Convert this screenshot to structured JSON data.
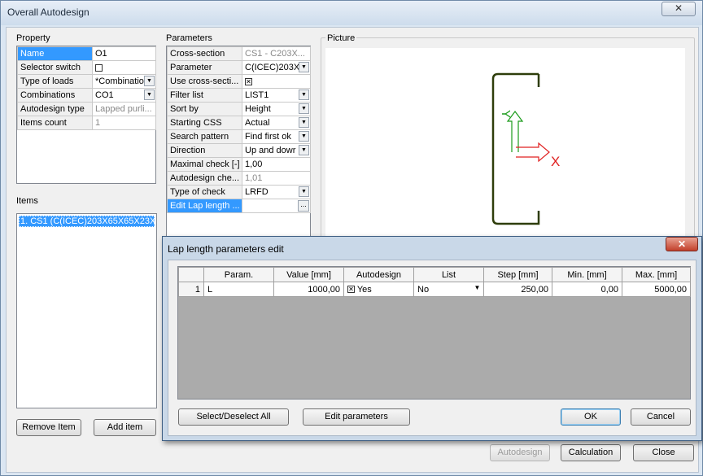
{
  "window": {
    "title": "Overall Autodesign",
    "close_glyph": "✕"
  },
  "property": {
    "label": "Property",
    "rows": [
      {
        "key": "Name",
        "value": "O1"
      },
      {
        "key": "Selector switch",
        "value": ""
      },
      {
        "key": "Type of loads",
        "value": "*Combinatior"
      },
      {
        "key": "Combinations",
        "value": "CO1"
      },
      {
        "key": "Autodesign type",
        "value": "Lapped purli..."
      },
      {
        "key": "Items count",
        "value": "1"
      }
    ]
  },
  "parameters": {
    "label": "Parameters",
    "rows": [
      {
        "key": "Cross-section",
        "value": "CS1 - C203X..."
      },
      {
        "key": "Parameter",
        "value": "C(ICEC)203X"
      },
      {
        "key": "Use cross-secti...",
        "value": ""
      },
      {
        "key": "Filter list",
        "value": "LIST1"
      },
      {
        "key": "Sort by",
        "value": "Height"
      },
      {
        "key": "Starting CSS",
        "value": "Actual"
      },
      {
        "key": "Search pattern",
        "value": "Find first ok"
      },
      {
        "key": "Direction",
        "value": "Up and dowr"
      },
      {
        "key": "Maximal check [-]",
        "value": "1,00"
      },
      {
        "key": "Autodesign che...",
        "value": "1,01"
      },
      {
        "key": "Type of check",
        "value": "LRFD"
      },
      {
        "key": "Edit Lap length ...",
        "value": ""
      }
    ]
  },
  "picture": {
    "label": "Picture",
    "axis_y": "Y",
    "axis_x": "X"
  },
  "items": {
    "label": "Items",
    "list": [
      "1. CS1 (C(ICEC)203X65X65X23X3)"
    ]
  },
  "buttons": {
    "remove_item": "Remove Item",
    "add_item": "Add item",
    "autodesign": "Autodesign",
    "calculation": "Calculation",
    "close": "Close"
  },
  "modal": {
    "title": "Lap length parameters edit",
    "close_glyph": "✕",
    "columns": [
      "Param.",
      "Value [mm]",
      "Autodesign",
      "List",
      "Step [mm]",
      "Min. [mm]",
      "Max. [mm]"
    ],
    "rows": [
      {
        "index": "1",
        "param": "L",
        "value": "1000,00",
        "autodesign": "Yes",
        "list": "No",
        "step": "250,00",
        "min": "0,00",
        "max": "5000,00"
      }
    ],
    "buttons": {
      "select_deselect": "Select/Deselect All",
      "edit_parameters": "Edit parameters",
      "ok": "OK",
      "cancel": "Cancel"
    }
  }
}
